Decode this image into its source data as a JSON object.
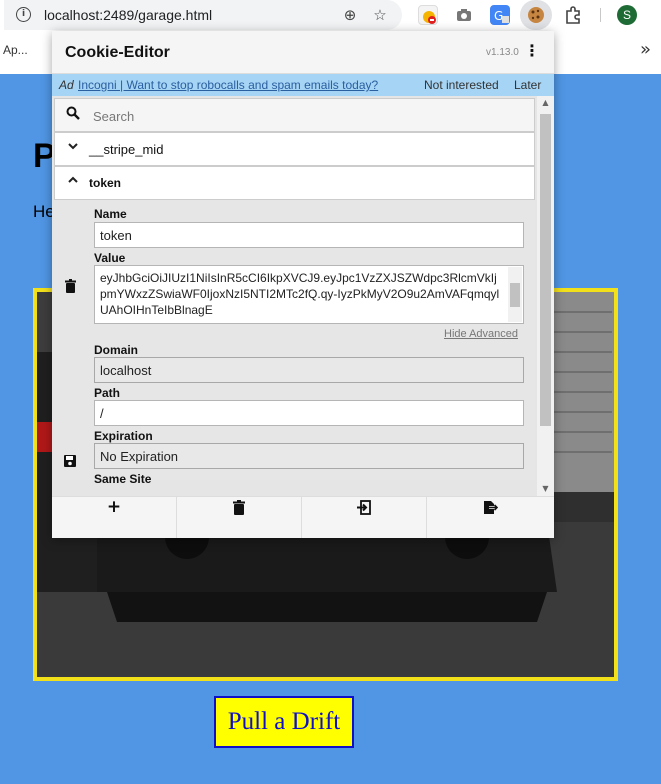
{
  "browser": {
    "url": "localhost:2489/garage.html",
    "info_glyph": "i",
    "zoom_glyph": "⊕",
    "star_glyph": "☆",
    "bookmark_apps": "Ap...",
    "bookmarks_more": "»",
    "avatar_letter": "S"
  },
  "page": {
    "heading": "P",
    "paragraph": "He",
    "drift_button": "Pull a Drift",
    "colors": {
      "background": "#5096e4",
      "frame": "#f2e01b",
      "button_bg": "#ffff00",
      "button_text": "#1010c8"
    }
  },
  "cookie_editor": {
    "title": "Cookie-Editor",
    "version": "v1.13.0",
    "menu_glyph": "⋮",
    "ad": {
      "tag": "Ad",
      "link_text": "Incogni | Want to stop robocalls and spam emails today?",
      "not_interested": "Not interested",
      "later": "Later"
    },
    "search_placeholder": "Search",
    "search_glyph": "⚲",
    "cookies": [
      {
        "name": "__stripe_mid",
        "chevron": "⌄"
      },
      {
        "name": "token",
        "chevron": "⌃"
      }
    ],
    "details": {
      "name_label": "Name",
      "name_value": "token",
      "value_label": "Value",
      "value_value": "eyJhbGciOiJIUzI1NiIsInR5cCI6IkpXVCJ9.eyJpc1VzZXJSZWdpc3RlcmVkIjpmYWxzZSwiaWF0IjoxNzI5NTI2MTc2fQ.qy-IyzPkMyV2O9u2AmVAFqmqylUAhOIHnTeIbBlnagE",
      "hide_advanced": "Hide Advanced",
      "domain_label": "Domain",
      "domain_value": "localhost",
      "path_label": "Path",
      "path_value": "/",
      "expiration_label": "Expiration",
      "expiration_value": "No Expiration",
      "samesite_label": "Same Site"
    },
    "footer": {
      "add_glyph": "+",
      "delete_glyph": "🗑",
      "import_glyph": "⇲",
      "export_glyph": "⇱"
    }
  }
}
